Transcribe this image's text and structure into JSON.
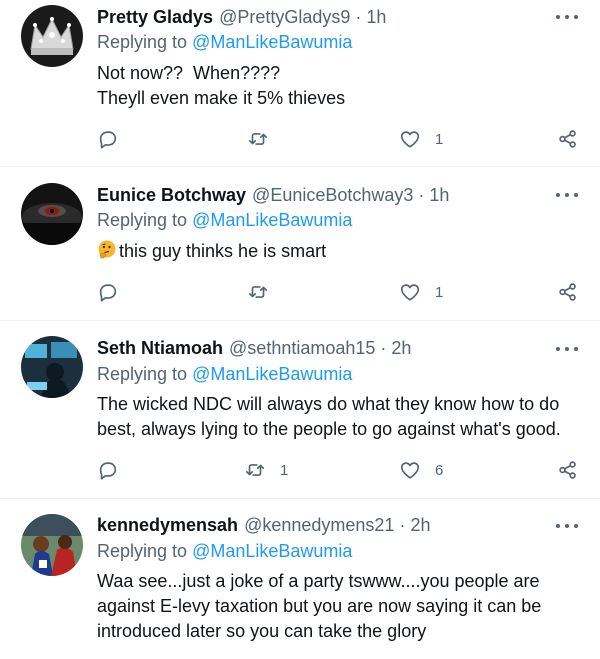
{
  "tweets": [
    {
      "name": "Pretty Gladys",
      "handle": "@PrettyGladys9",
      "dot": "·",
      "time": "1h",
      "replying_prefix": "Replying to",
      "replying_to": "@ManLikeBawumia",
      "lines": [
        "Not now??  When????",
        "Theyll even make it 5% thieves"
      ],
      "reply_count": "",
      "retweet_count": "",
      "like_count": "1"
    },
    {
      "name": "Eunice Botchway",
      "handle": "@EuniceBotchway3",
      "dot": "·",
      "time": "1h",
      "replying_prefix": "Replying to",
      "replying_to": "@ManLikeBawumia",
      "emoji": "thinking-face",
      "lines": [
        "this guy thinks he is smart"
      ],
      "reply_count": "",
      "retweet_count": "",
      "like_count": "1"
    },
    {
      "name": "Seth Ntiamoah",
      "handle": "@sethntiamoah15",
      "dot": "·",
      "time": "2h",
      "replying_prefix": "Replying to",
      "replying_to": "@ManLikeBawumia",
      "lines": [
        "The wicked NDC will always do what they know how to do",
        "best, always lying to the people to go against what's good."
      ],
      "reply_count": "",
      "retweet_count": "1",
      "like_count": "6"
    },
    {
      "name": "kennedymensah",
      "handle": "@kennedymens21",
      "dot": "·",
      "time": "2h",
      "replying_prefix": "Replying to",
      "replying_to": "@ManLikeBawumia",
      "lines": [
        "Waa see...just a joke of a party tswww....you people are",
        "against E-levy taxation but you are now saying it can be",
        "introduced later so you can take the glory"
      ]
    }
  ],
  "icons": {
    "reply": "reply-icon",
    "retweet": "retweet-icon",
    "like": "heart-icon",
    "share": "share-icon",
    "more": "more-options-icon"
  },
  "colors": {
    "link": "#1d9bf0",
    "secondary_text": "#536471",
    "divider": "#eff3f4"
  }
}
